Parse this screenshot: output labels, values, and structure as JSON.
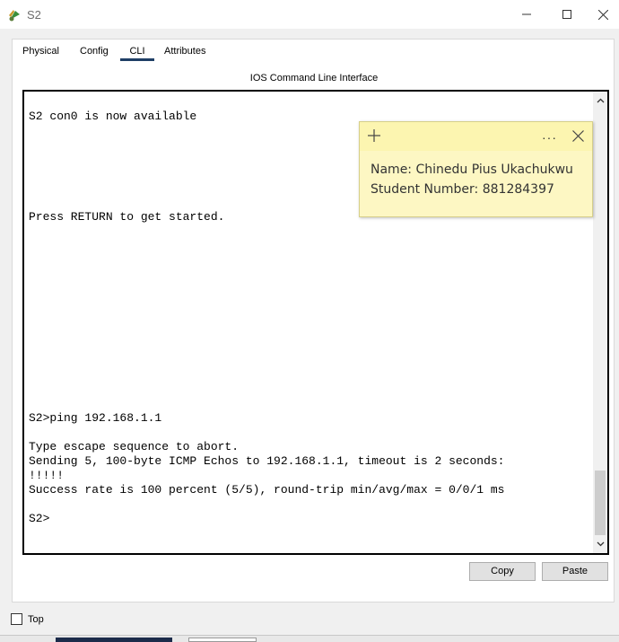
{
  "window": {
    "title": "S2",
    "icon": "router-switch-icon",
    "controls": [
      "minimize-icon",
      "maximize-icon",
      "close-icon"
    ]
  },
  "tabs": [
    {
      "label": "Physical",
      "active": false
    },
    {
      "label": "Config",
      "active": false
    },
    {
      "label": "CLI",
      "active": true
    },
    {
      "label": "Attributes",
      "active": false
    }
  ],
  "cli": {
    "heading": "IOS Command Line Interface",
    "lines": [
      "S2 con0 is now available",
      "Press RETURN to get started.",
      "S2>ping 192.168.1.1",
      "Type escape sequence to abort.",
      "Sending 5, 100-byte ICMP Echos to 192.168.1.1, timeout is 2 seconds:",
      "!!!!!",
      "Success rate is 100 percent (5/5), round-trip min/avg/max = 0/0/1 ms",
      "S2>"
    ]
  },
  "sticky_note": {
    "line1": "Name: Chinedu Pius Ukachukwu",
    "line2": "Student Number: 881284397",
    "more": "···"
  },
  "buttons": {
    "copy": "Copy",
    "paste": "Paste"
  },
  "top_option": {
    "label": "Top",
    "checked": false
  },
  "colors": {
    "active_tab_underline": "#1f3f66",
    "sticky_background": "#fdf7c3"
  }
}
